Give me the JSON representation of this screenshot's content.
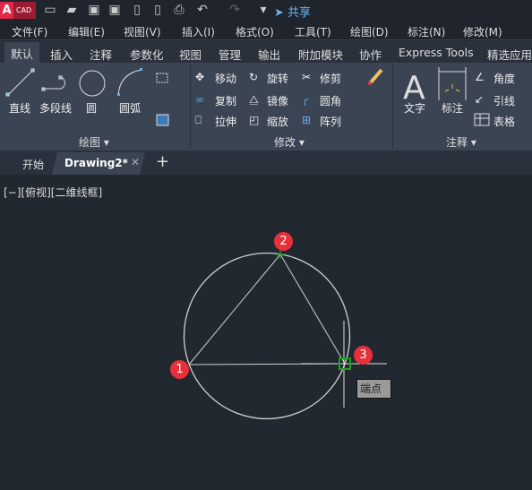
{
  "app": {
    "logo_letter": "A",
    "logo_text": "CAD",
    "share_label": "共享"
  },
  "quick_access": [
    "new-icon",
    "open-icon",
    "save-icon",
    "save-as-icon",
    "open-from-mobile-icon",
    "save-to-mobile-icon",
    "print-icon",
    "undo-icon",
    "redo-icon",
    "customize-icon"
  ],
  "menu": [
    "文件(F)",
    "编辑(E)",
    "视图(V)",
    "插入(I)",
    "格式(O)",
    "工具(T)",
    "绘图(D)",
    "标注(N)",
    "修改(M)"
  ],
  "ribbon_tabs": [
    "默认",
    "插入",
    "注释",
    "参数化",
    "视图",
    "管理",
    "输出",
    "附加模块",
    "协作",
    "Express Tools",
    "精选应用"
  ],
  "draw_panel": {
    "title": "绘图",
    "tools": [
      "直线",
      "多段线",
      "圆",
      "圆弧"
    ]
  },
  "modify_panel": {
    "title": "修改",
    "tools": [
      "移动",
      "旋转",
      "修剪",
      "复制",
      "镜像",
      "圆角",
      "拉伸",
      "缩放",
      "阵列"
    ]
  },
  "annotate_panel": {
    "title": "注释",
    "tools": [
      "文字",
      "标注",
      "角度",
      "引线",
      "表格"
    ]
  },
  "doc_tabs": {
    "start": "开始",
    "active": "Drawing2*",
    "new": "+"
  },
  "viewport_label": "[−][俯视][二维线框]",
  "markers": [
    "1",
    "2",
    "3"
  ],
  "snap_tooltip": "端点",
  "colors": {
    "accent": "#e8303a",
    "snap": "#1ea01e",
    "geometry": "#d0d0d0"
  }
}
